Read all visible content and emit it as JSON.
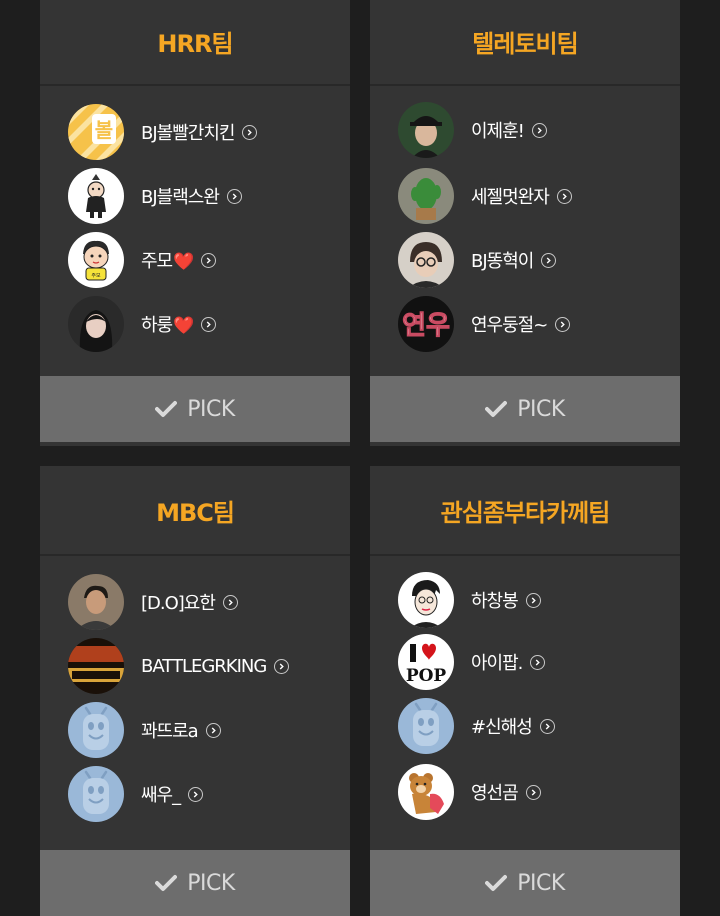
{
  "teams": [
    {
      "title": "HRR팀",
      "members": [
        {
          "name": "BJ볼빨간치킨",
          "heart": "",
          "avatar_icon": "bol-logo-avatar",
          "avatar_color": "#f6c24a"
        },
        {
          "name": "BJ블랙스완",
          "heart": "",
          "avatar_icon": "swan-cartoon-avatar",
          "avatar_color": "#ffffff"
        },
        {
          "name": "주모",
          "heart": "❤️",
          "avatar_icon": "cartoon-boy-avatar",
          "avatar_color": "#ffffff"
        },
        {
          "name": "하룽",
          "heart": "❤️",
          "avatar_icon": "girl-photo-avatar",
          "avatar_color": "#2a2a2a"
        }
      ],
      "pick_label": "PICK"
    },
    {
      "title": "텔레토비팀",
      "members": [
        {
          "name": "이제훈!",
          "heart": "",
          "avatar_icon": "cap-man-photo-avatar",
          "avatar_color": "#1f3a22"
        },
        {
          "name": "세젤멋완자",
          "heart": "",
          "avatar_icon": "cactus-avatar",
          "avatar_color": "#6c8f5a"
        },
        {
          "name": "BJ똥혁이",
          "heart": "",
          "avatar_icon": "glasses-man-photo-avatar",
          "avatar_color": "#cfc8c0"
        },
        {
          "name": "연우둥절~",
          "heart": "",
          "avatar_icon": "yeonu-text-avatar",
          "avatar_color": "#111111"
        }
      ],
      "pick_label": "PICK"
    },
    {
      "title": "MBC팀",
      "members": [
        {
          "name": "[D.O]요한",
          "heart": "",
          "avatar_icon": "man-photo-avatar",
          "avatar_color": "#7a6a5a"
        },
        {
          "name": "BATTLEGRKING",
          "heart": "",
          "avatar_icon": "battlegrounds-avatar",
          "avatar_color": "#2a1a10"
        },
        {
          "name": "꽈뜨로a",
          "heart": "",
          "avatar_icon": "default-tv-avatar",
          "avatar_color": "#9ab8d8"
        },
        {
          "name": "쌔우_",
          "heart": "",
          "avatar_icon": "default-tv-avatar",
          "avatar_color": "#9ab8d8"
        }
      ],
      "pick_label": "PICK"
    },
    {
      "title": "관심좀부타카께팀",
      "members": [
        {
          "name": "하창봉",
          "heart": "",
          "avatar_icon": "sketch-face-avatar",
          "avatar_color": "#ffffff"
        },
        {
          "name": "아이팝.",
          "heart": "",
          "avatar_icon": "i-love-pop-avatar",
          "avatar_color": "#ffffff",
          "logo_text": "POP"
        },
        {
          "name": "#신해성",
          "heart": "",
          "avatar_icon": "default-tv-avatar",
          "avatar_color": "#9ab8d8"
        },
        {
          "name": "영선곰",
          "heart": "",
          "avatar_icon": "bear-illustration-avatar",
          "avatar_color": "#ffffff"
        }
      ],
      "pick_label": "PICK"
    }
  ],
  "colors": {
    "title": "#f5a623",
    "card": "#343434",
    "pick": "#6d6d6d",
    "background": "#1e1e1e"
  }
}
